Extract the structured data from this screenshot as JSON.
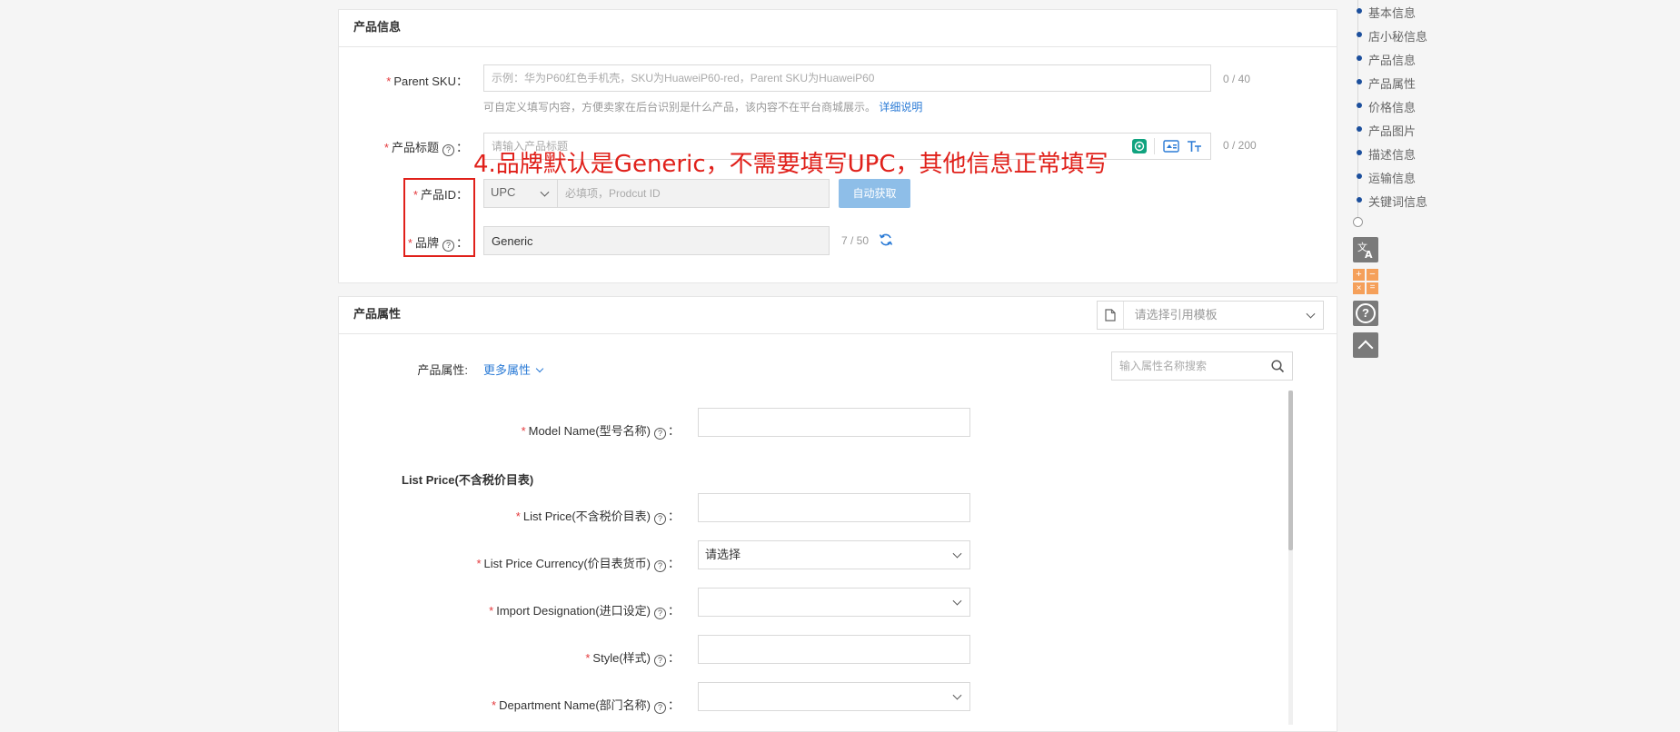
{
  "product_info": {
    "section_title": "产品信息",
    "parent_sku": {
      "label": "Parent SKU",
      "placeholder": "示例：华为P60红色手机壳，SKU为HuaweiP60-red，Parent SKU为HuaweiP60",
      "counter": "0 / 40",
      "hint": "可自定义填写内容，方便卖家在后台识别是什么产品，该内容不在平台商城展示。",
      "hint_link": "详细说明"
    },
    "title": {
      "label": "产品标题",
      "placeholder": "请输入产品标题",
      "counter": "0 / 200"
    },
    "product_id": {
      "label": "产品ID",
      "type_value": "UPC",
      "placeholder": "必填项，Prodcut ID",
      "auto_button": "自动获取"
    },
    "brand": {
      "label": "品牌",
      "value": "Generic",
      "counter": "7 / 50"
    },
    "annotation": "4.品牌默认是Generic，不需要填写UPC，其他信息正常填写"
  },
  "product_attrs": {
    "section_title": "产品属性",
    "template_placeholder": "请选择引用模板",
    "attrs_label": "产品属性:",
    "more_attrs": "更多属性",
    "search_placeholder": "输入属性名称搜索",
    "group_title": "List Price(不含税价目表)",
    "fields": [
      {
        "label": "Model Name(型号名称)",
        "kind": "input",
        "value": ""
      },
      {
        "label": "List Price(不含税价目表)",
        "kind": "input",
        "value": ""
      },
      {
        "label": "List Price Currency(价目表货币)",
        "kind": "select",
        "value": "请选择"
      },
      {
        "label": "Import Designation(进口设定)",
        "kind": "select",
        "value": ""
      },
      {
        "label": "Style(样式)",
        "kind": "input",
        "value": ""
      },
      {
        "label": "Department Name(部门名称)",
        "kind": "select",
        "value": ""
      }
    ]
  },
  "side_nav": {
    "items": [
      "基本信息",
      "店小秘信息",
      "产品信息",
      "产品属性",
      "价格信息",
      "产品图片",
      "描述信息",
      "运输信息",
      "关键词信息"
    ]
  },
  "colors": {
    "accent": "#2b7bd6",
    "required": "#e4393c",
    "annotation": "#e0201a",
    "nav_dot": "#1c4f9c",
    "calc_orange": "#f5a05a"
  }
}
